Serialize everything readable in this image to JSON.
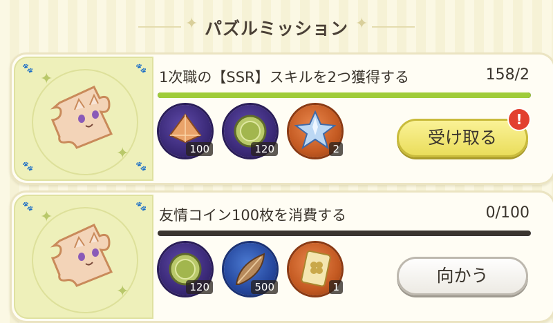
{
  "header": {
    "title": "パズルミッション"
  },
  "missions": [
    {
      "task": "1次職の【SSR】スキルを2つ獲得する",
      "progress_text": "158/2",
      "progress": 1.0,
      "bar_color": "#9fcc3a",
      "rewards": [
        {
          "icon": "orange-crystal-pyramid-icon",
          "count": "100",
          "frame": "purple"
        },
        {
          "icon": "green-coin-icon",
          "count": "120",
          "frame": "purple"
        },
        {
          "icon": "blue-star-crystal-icon",
          "count": "2",
          "frame": "orange"
        }
      ],
      "button": "受け取る",
      "notification": "!"
    },
    {
      "task": "友情コイン100枚を消費する",
      "progress_text": "0/100",
      "progress": 0.0,
      "bar_color": "#9fcc3a",
      "rewards": [
        {
          "icon": "green-coin-icon",
          "count": "120",
          "frame": "purple"
        },
        {
          "icon": "feather-leaf-icon",
          "count": "500",
          "frame": "blue"
        },
        {
          "icon": "clover-card-icon",
          "count": "1",
          "frame": "orange"
        }
      ],
      "button": "向かう"
    }
  ],
  "colors": {
    "claim_button": "#f3ea7a",
    "badge": "#e2402f",
    "progress_fill": "#9fcc3a",
    "track": "#3b3530"
  }
}
